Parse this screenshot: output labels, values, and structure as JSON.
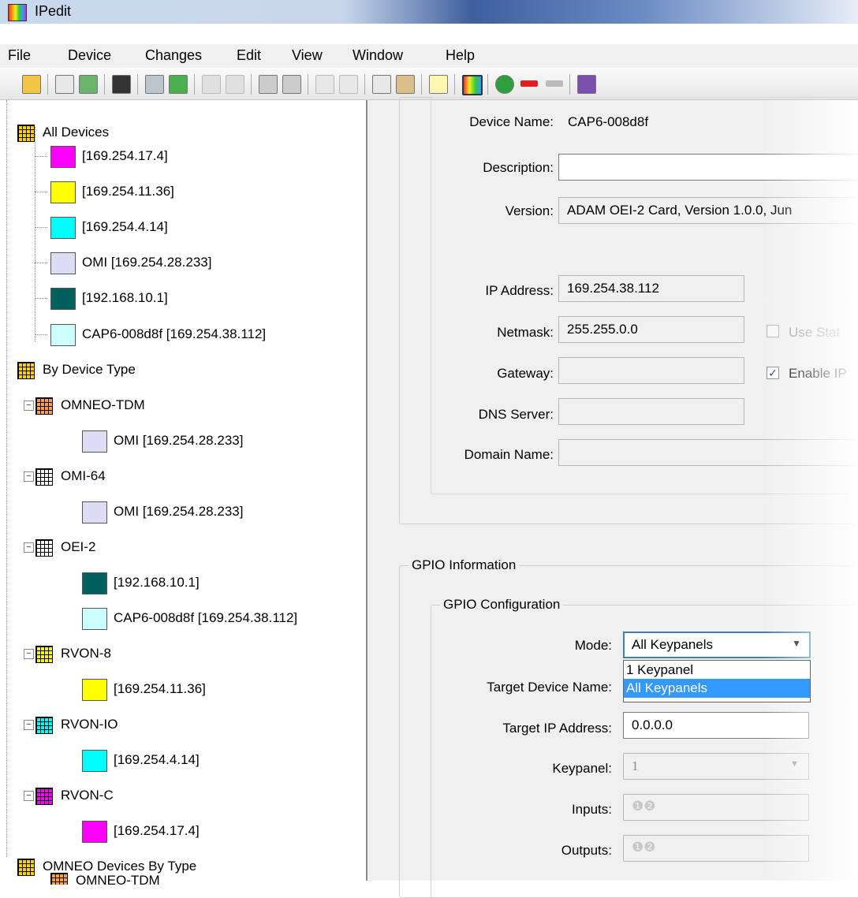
{
  "window": {
    "title": "IPedit"
  },
  "menu": [
    "File",
    "Device",
    "Changes",
    "Edit",
    "View",
    "Window",
    "Help"
  ],
  "toolbar_icons": [
    "open-icon",
    "copy-icon",
    "export-icon",
    "save-icon",
    "apply-icon",
    "discard-icon",
    "arrow-icon",
    "cancel-icon",
    "grid-icon",
    "grid-x-icon",
    "undo-icon",
    "redo-icon",
    "copy2-icon",
    "paste-icon",
    "check-icon",
    "palette-icon",
    "refresh-icon",
    "back-icon",
    "forward-icon",
    "book-icon"
  ],
  "tree": {
    "all_devices": {
      "label": "All Devices",
      "items": [
        {
          "label": "[169.254.17.4]",
          "color": "#ff00ff"
        },
        {
          "label": "[169.254.11.36]",
          "color": "#ffff00"
        },
        {
          "label": "[169.254.4.14]",
          "color": "#00ffff"
        },
        {
          "label": "OMI [169.254.28.233]",
          "color": "#dcdcf5"
        },
        {
          "label": "[192.168.10.1]",
          "color": "#006060"
        },
        {
          "label": "CAP6-008d8f [169.254.38.112]",
          "color": "#ccffff"
        }
      ]
    },
    "by_type": {
      "label": "By Device Type",
      "groups": [
        {
          "label": "OMNEO-TDM",
          "color": "#ffa040",
          "child": {
            "label": "OMI [169.254.28.233]",
            "color": "#dcdcf5"
          }
        },
        {
          "label": "OMI-64",
          "color": "#ffffff",
          "child": {
            "label": "OMI [169.254.28.233]",
            "color": "#dcdcf5"
          }
        },
        {
          "label": "OEI-2",
          "color": "#ffffff",
          "children": [
            {
              "label": "[192.168.10.1]",
              "color": "#006060"
            },
            {
              "label": "CAP6-008d8f [169.254.38.112]",
              "color": "#ccffff"
            }
          ]
        },
        {
          "label": "RVON-8",
          "color": "#ffff00",
          "child": {
            "label": "[169.254.11.36]",
            "color": "#ffff00"
          }
        },
        {
          "label": "RVON-IO",
          "color": "#00ffff",
          "child": {
            "label": "[169.254.4.14]",
            "color": "#00ffff"
          }
        },
        {
          "label": "RVON-C",
          "color": "#ff00ff",
          "child": {
            "label": "[169.254.17.4]",
            "color": "#ff00ff"
          }
        }
      ]
    },
    "omneo": {
      "label": "OMNEO Devices By Type",
      "partial": "OMNEO-TDM"
    }
  },
  "device": {
    "name_label": "Device Name:",
    "name_value": "CAP6-008d8f",
    "desc_label": "Description:",
    "desc_value": "",
    "version_label": "Version:",
    "version_value": "ADAM OEI-2 Card, Version 1.0.0, Jun",
    "ip_label": "IP Address:",
    "ip_value": "169.254.38.112",
    "netmask_label": "Netmask:",
    "netmask_value": "255.255.0.0",
    "gateway_label": "Gateway:",
    "gateway_value": "",
    "dns_label": "DNS Server:",
    "dns_value": "",
    "domain_label": "Domain Name:",
    "domain_value": "",
    "use_static_label": "Use Stat",
    "enable_ip_label": "Enable IP"
  },
  "gpio": {
    "section_title": "GPIO Information",
    "config_title": "GPIO Configuration",
    "mode_label": "Mode:",
    "mode_value": "All Keypanels",
    "mode_options": [
      "1 Keypanel",
      "All Keypanels"
    ],
    "target_name_label": "Target Device Name:",
    "target_ip_label": "Target IP Address:",
    "target_ip_value": "0.0.0.0",
    "keypanel_label": "Keypanel:",
    "keypanel_value": "1",
    "inputs_label": "Inputs:",
    "outputs_label": "Outputs:",
    "io_glyphs": "❶❷"
  }
}
